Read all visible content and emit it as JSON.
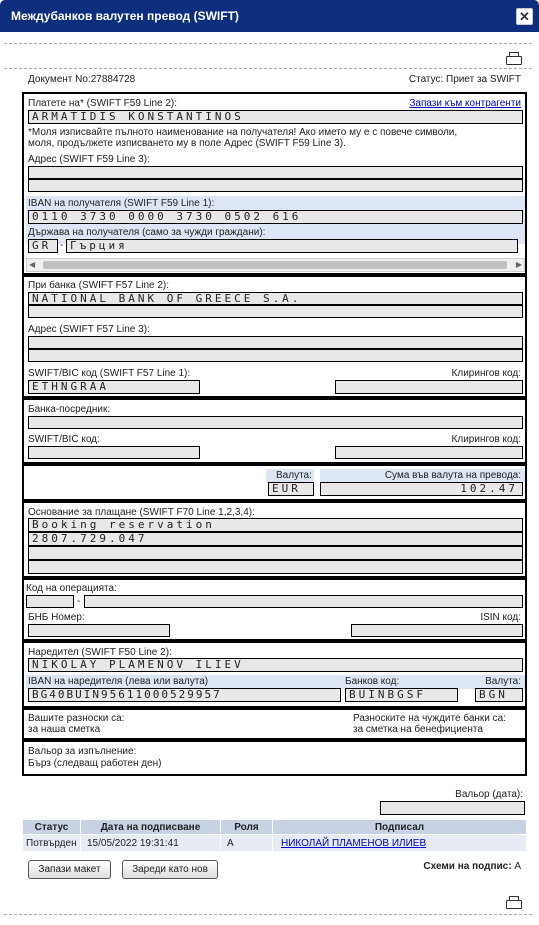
{
  "window": {
    "title": "Междубанков валутен превод (SWIFT)",
    "close": "✕"
  },
  "doc": {
    "number_label": "Документ No:",
    "number": "27884728",
    "status_label": "Статус:",
    "status": "Приет за SWIFT"
  },
  "beneficiary": {
    "name_label": "Платете на* (SWIFT F59 Line 2):",
    "save_link": "Запази към контрагенти",
    "name": "ARMATIDIS KONSTANTINOS",
    "note1": "*Моля изписвайте пълното наименование на получателя! Ако името му е с повече символи,",
    "note2": "моля, продължете изписването му в поле Адрес (SWIFT F59 Line 3).",
    "address_label": "Адрес (SWIFT F59 Line 3):",
    "iban_label": "IBAN на получателя (SWIFT F59 Line 1):",
    "iban": "0110 3730 0000 3730 0502 616",
    "country_label": "Държава на получателя (само за чужди граждани):",
    "country_code": "GR",
    "country_sep": "-",
    "country_name": "Гърция"
  },
  "bank": {
    "name_label": "При банка (SWIFT F57 Line 2):",
    "name": "NATIONAL BANK OF GREECE S.A.",
    "address_label": "Адрес (SWIFT F57 Line 3):",
    "bic_label": "SWIFT/BIC код (SWIFT F57 Line 1):",
    "bic": "ETHNGRAA",
    "clearing_label": "Клирингов код:"
  },
  "intermediary": {
    "label": "Банка-посредник:",
    "bic_label": "SWIFT/BIC код:",
    "clearing_label": "Клирингов код:"
  },
  "amount": {
    "currency_label": "Валута:",
    "currency": "EUR",
    "amount_label": "Сума във валута на превода:",
    "amount": "102.47"
  },
  "reason": {
    "label": "Основание за плащане (SWIFT F70 Line 1,2,3,4):",
    "line1": "Booking reservation",
    "line2": "2807.729.047"
  },
  "operation": {
    "code_label": "Код на операцията:",
    "code_sep": "-",
    "bnb_label": "БНБ Номер:",
    "isin_label": "ISIN код:"
  },
  "orderer": {
    "label": "Наредител (SWIFT F50 Line 2):",
    "name": "NIKOLAY PLAMENOV ILIEV",
    "iban_label": "IBAN на наредителя (лева или валута)",
    "iban": "BG40BUIN95611000529957",
    "bank_code_label": "Банков код:",
    "bank_code": "BUINBGSF",
    "currency_label": "Валута:",
    "currency": "BGN"
  },
  "fees": {
    "own_label": "Вашите разноски са:",
    "own_value": "за наша сметка",
    "foreign_label": "Разноските на чуждите банки са:",
    "foreign_value": "за сметка на бенефициента"
  },
  "value_date": {
    "label": "Вальор за изпълнение:",
    "value": "Бърз (следващ работен ден)",
    "date_label": "Вальор (дата):"
  },
  "signatures": {
    "headers": [
      "Статус",
      "Дата на подписване",
      "Роля",
      "Подписал"
    ],
    "rows": [
      [
        "Потвърден",
        "15/05/2022 19:31:41",
        "A",
        "НИКОЛАЙ ПЛАМЕНОВ ИЛИЕВ"
      ]
    ]
  },
  "actions": {
    "save_template": "Запази макет",
    "load_new": "Зареди като нов",
    "schemes_label": "Схеми на подпис:",
    "schemes_value": "A"
  }
}
